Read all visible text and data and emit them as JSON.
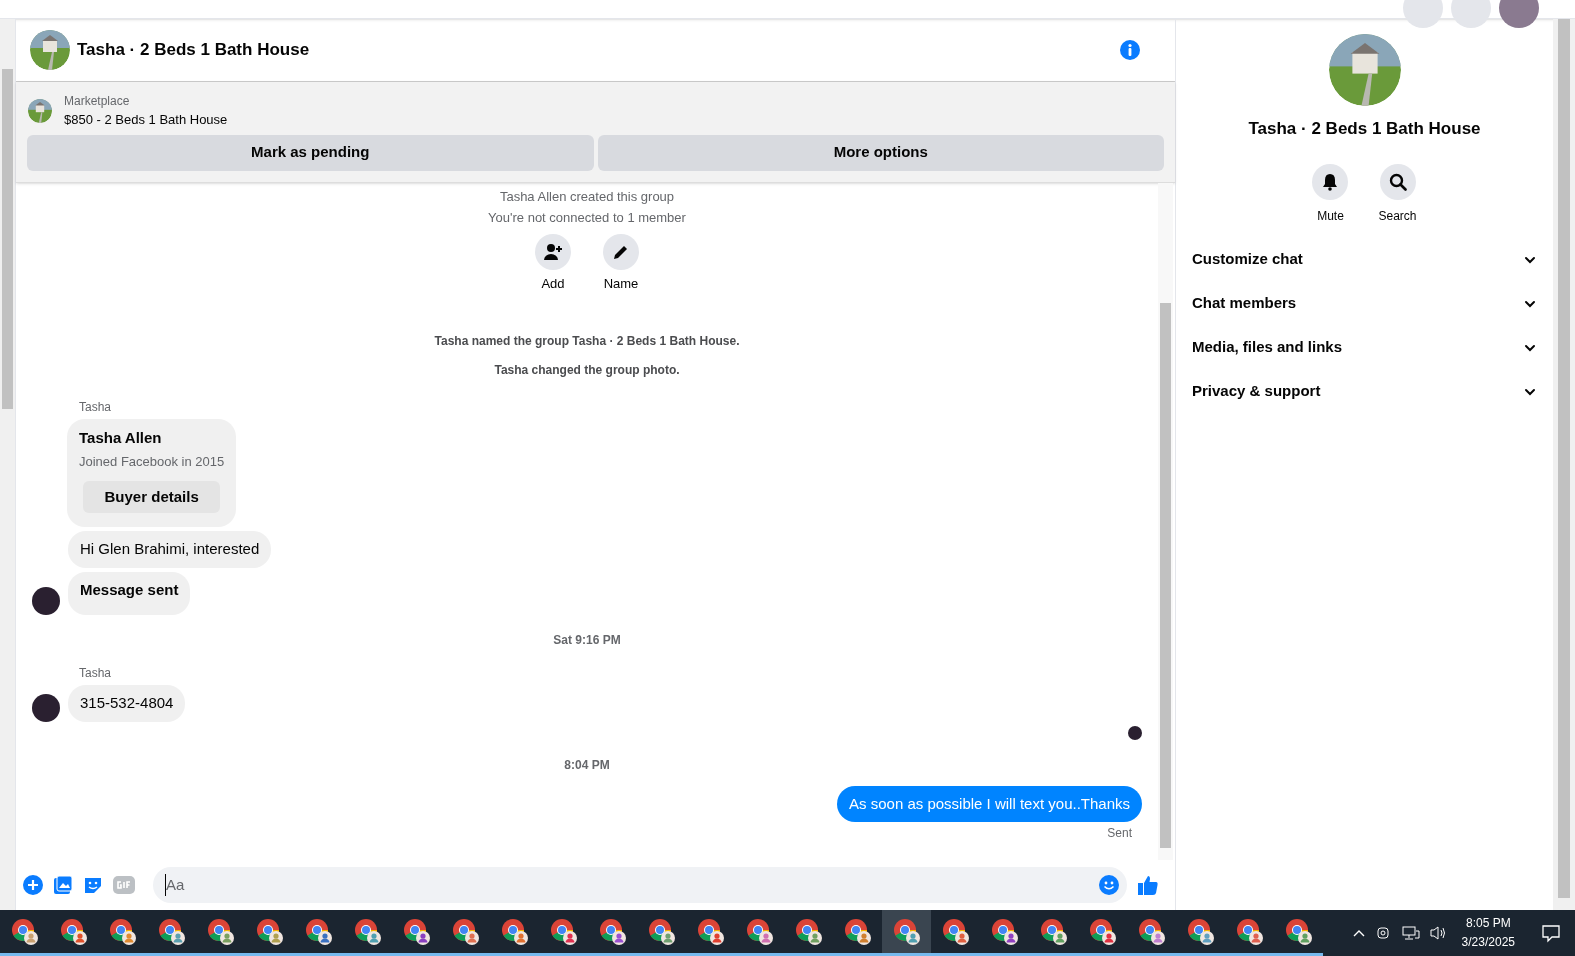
{
  "chat": {
    "title": "Tasha · 2 Beds 1 Bath House"
  },
  "listing": {
    "source": "Marketplace",
    "title": "$850 - 2 Beds 1 Bath House",
    "buttons": [
      "Mark as pending",
      "More options"
    ]
  },
  "messages": [
    {
      "kind": "notice",
      "text": "Tasha Allen created this group"
    },
    {
      "kind": "notice",
      "text": "You're not connected to 1 member"
    },
    {
      "kind": "actions",
      "actions": [
        "Add",
        "Name"
      ]
    },
    {
      "kind": "event",
      "text": "Tasha named the group Tasha · 2 Beds 1 Bath House."
    },
    {
      "kind": "event",
      "text": "Tasha changed the group photo."
    },
    {
      "kind": "sender",
      "text": "Tasha"
    },
    {
      "kind": "card",
      "name": "Tasha Allen",
      "subtitle": "Joined Facebook in 2015",
      "button": "Buyer details"
    },
    {
      "kind": "incoming",
      "text": "Hi Glen Brahimi, interested",
      "avatar": false,
      "bold": false
    },
    {
      "kind": "incoming",
      "text": "Message sent",
      "avatar": true,
      "bold": true
    },
    {
      "kind": "time",
      "text": "Sat 9:16 PM"
    },
    {
      "kind": "sender",
      "text": "Tasha"
    },
    {
      "kind": "incoming",
      "text": "315-532-4804",
      "avatar": true,
      "bold": false
    },
    {
      "kind": "receipt"
    },
    {
      "kind": "time",
      "text": "8:04 PM"
    },
    {
      "kind": "outgoing",
      "text": "As soon as possible I will text you..Thanks"
    },
    {
      "kind": "status",
      "text": "Sent"
    }
  ],
  "composer": {
    "placeholder": "Aa"
  },
  "details": {
    "title": "Tasha · 2 Beds 1 Bath House",
    "actions": [
      "Mute",
      "Search"
    ],
    "sections": [
      {
        "label": "Customize chat",
        "expanded": false
      },
      {
        "label": "Chat members",
        "expanded": false
      },
      {
        "label": "Media, files and links",
        "expanded": false
      },
      {
        "label": "Privacy & support",
        "expanded": false
      }
    ]
  },
  "taskbar": {
    "apps": [
      {
        "color": "#c8a070",
        "selected": false
      },
      {
        "color": "#e0502a",
        "selected": false
      },
      {
        "color": "#e08a30",
        "selected": false
      },
      {
        "color": "#5aa0b0",
        "selected": false
      },
      {
        "color": "#7aa060",
        "selected": false
      },
      {
        "color": "#b0a050",
        "selected": false
      },
      {
        "color": "#3a70c0",
        "selected": false
      },
      {
        "color": "#50a0b0",
        "selected": false
      },
      {
        "color": "#8a40c0",
        "selected": false
      },
      {
        "color": "#e07050",
        "selected": false
      },
      {
        "color": "#e07030",
        "selected": false
      },
      {
        "color": "#e03050",
        "selected": false
      },
      {
        "color": "#9a50d0",
        "selected": false
      },
      {
        "color": "#70a070",
        "selected": false
      },
      {
        "color": "#e04030",
        "selected": false
      },
      {
        "color": "#d070b0",
        "selected": false
      },
      {
        "color": "#70a060",
        "selected": false
      },
      {
        "color": "#d08030",
        "selected": false
      },
      {
        "color": "#50a0b0",
        "selected": true
      },
      {
        "color": "#e06040",
        "selected": false
      },
      {
        "color": "#9040c0",
        "selected": false
      },
      {
        "color": "#60a060",
        "selected": false
      },
      {
        "color": "#e03040",
        "selected": false
      },
      {
        "color": "#c080d0",
        "selected": false
      },
      {
        "color": "#60a0c0",
        "selected": false
      },
      {
        "color": "#e06050",
        "selected": false
      },
      {
        "color": "#60a060",
        "selected": false
      }
    ],
    "time": "8:05 PM",
    "date": "3/23/2025"
  }
}
